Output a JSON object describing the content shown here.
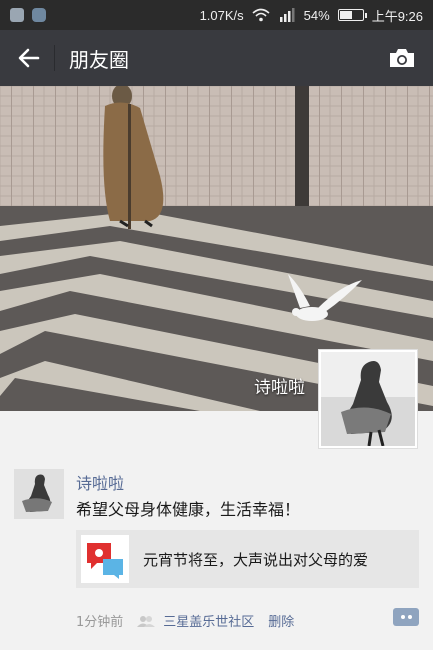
{
  "status_bar": {
    "speed": "1.07K/s",
    "battery": "54%",
    "battery_level": 0.54,
    "time": "上午9:26"
  },
  "header": {
    "title": "朋友圈",
    "back_icon": "arrow-left-icon",
    "camera_icon": "camera-icon"
  },
  "cover": {
    "user_name": "诗啦啦"
  },
  "post": {
    "author": "诗啦啦",
    "text": "希望父母身体健康，生活幸福！",
    "share": {
      "title": "元宵节将至，大声说出对父母的爱",
      "thumb_colors": [
        "#e0302f",
        "#5bb4e5"
      ]
    },
    "time": "1分钟前",
    "location": "三星盖乐世社区",
    "delete_label": "删除"
  },
  "colors": {
    "appbar": "#393a3f",
    "link": "#576b95"
  }
}
